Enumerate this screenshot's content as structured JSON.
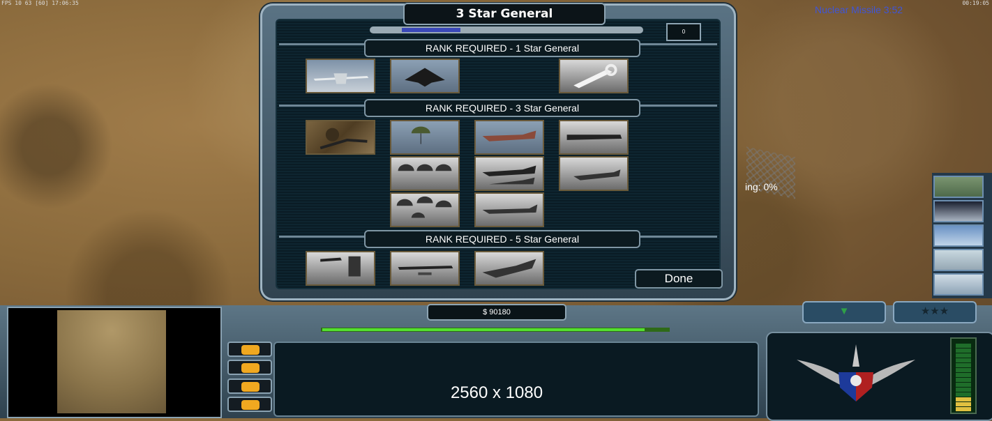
{
  "hud": {
    "top_left": "FPS 10 63 [60] 17:06:35",
    "top_right": "00:19:05",
    "superweapon_timer": "Nuclear Missile 3:52",
    "progress_text": "ing: 0%"
  },
  "promotion_panel": {
    "title": "3 Star General",
    "points_available": "0",
    "points_progress": 0.22,
    "rank_sections": [
      {
        "header": "RANK REQUIRED - 1 Star General",
        "powers": [
          "predator-drone",
          "stealth-fighter",
          "",
          "emergency-repair"
        ]
      },
      {
        "header": "RANK REQUIRED - 3 Star General",
        "powers": [
          "pathfinder",
          "paradrop-1",
          "a10-strike-1",
          "spectre-gunship",
          "paradrop-2",
          "a10-strike-2",
          "fuel-air-bomb",
          "paradrop-3",
          "a10-strike-3"
        ]
      },
      {
        "header": "RANK REQUIRED - 5 Star General",
        "powers": [
          "supply-drop-zone",
          "daisy-cutter",
          "fuel-air-bomb-2"
        ]
      }
    ],
    "done_label": "Done"
  },
  "build_queue": [
    "spy-satellite-scan",
    "spectre-gunship",
    "a10-strike",
    "paradrop",
    "predator-drone"
  ],
  "control_bar": {
    "cash": "$ 90180",
    "power_level": 0.93,
    "command_buttons": [
      "options",
      "repair",
      "alert",
      "chat"
    ],
    "overlay_text": "2560 x 1080",
    "tab_stars": "★★★",
    "tab_arrow": "▼",
    "energy_segments_total": 14,
    "energy_segments_on": 3
  },
  "colors": {
    "panel_border": "#9fb4c2",
    "timer_blue": "#3f55d8",
    "power_green": "#54e030",
    "points_blue": "#3a48b8"
  }
}
